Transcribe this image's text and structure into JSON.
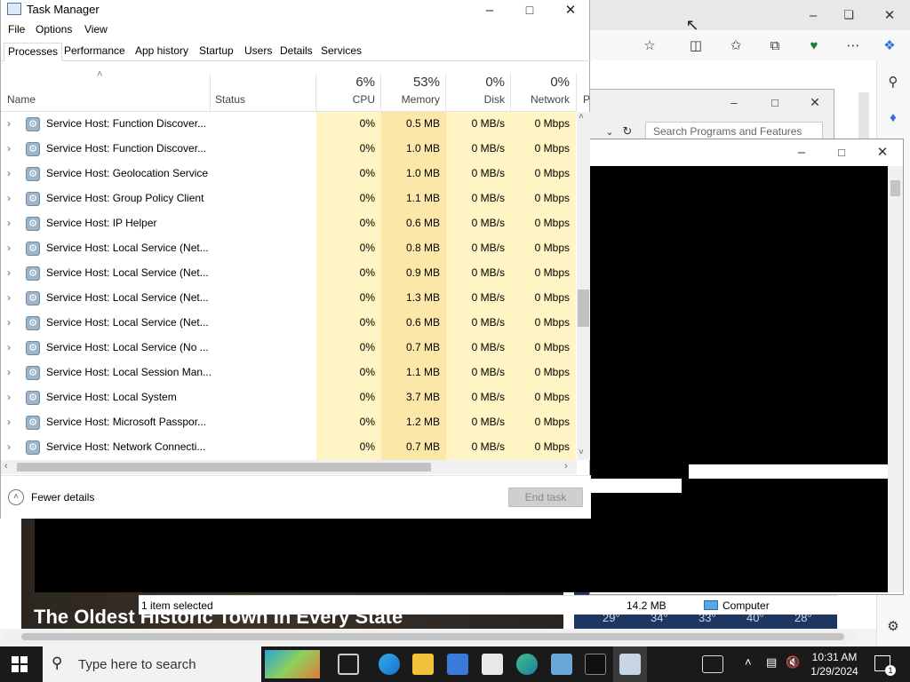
{
  "edge": {
    "search_programs_placeholder": "Search Programs and Features",
    "headline": "The Oldest Historic Town In Every State",
    "weather_temps": [
      "29°",
      "34°",
      "33°",
      "40°",
      "28°"
    ]
  },
  "console_status": {
    "selected": "1 item selected",
    "size": "14.2 MB",
    "location": "Computer"
  },
  "task_manager": {
    "title": "Task Manager",
    "menu": [
      "File",
      "Options",
      "View"
    ],
    "tabs": [
      "Processes",
      "Performance",
      "App history",
      "Startup",
      "Users",
      "Details",
      "Services"
    ],
    "active_tab": "Processes",
    "columns": {
      "name": "Name",
      "status": "Status",
      "cpu_pct": "6%",
      "cpu": "CPU",
      "mem_pct": "53%",
      "mem": "Memory",
      "disk_pct": "0%",
      "disk": "Disk",
      "net_pct": "0%",
      "net": "Network",
      "power": "P"
    },
    "rows": [
      {
        "name": "Service Host: Function Discover...",
        "cpu": "0%",
        "memory": "0.5 MB",
        "disk": "0 MB/s",
        "network": "0 Mbps"
      },
      {
        "name": "Service Host: Function Discover...",
        "cpu": "0%",
        "memory": "1.0 MB",
        "disk": "0 MB/s",
        "network": "0 Mbps"
      },
      {
        "name": "Service Host: Geolocation Service",
        "cpu": "0%",
        "memory": "1.0 MB",
        "disk": "0 MB/s",
        "network": "0 Mbps"
      },
      {
        "name": "Service Host: Group Policy Client",
        "cpu": "0%",
        "memory": "1.1 MB",
        "disk": "0 MB/s",
        "network": "0 Mbps"
      },
      {
        "name": "Service Host: IP Helper",
        "cpu": "0%",
        "memory": "0.6 MB",
        "disk": "0 MB/s",
        "network": "0 Mbps"
      },
      {
        "name": "Service Host: Local Service (Net...",
        "cpu": "0%",
        "memory": "0.8 MB",
        "disk": "0 MB/s",
        "network": "0 Mbps"
      },
      {
        "name": "Service Host: Local Service (Net...",
        "cpu": "0%",
        "memory": "0.9 MB",
        "disk": "0 MB/s",
        "network": "0 Mbps"
      },
      {
        "name": "Service Host: Local Service (Net...",
        "cpu": "0%",
        "memory": "1.3 MB",
        "disk": "0 MB/s",
        "network": "0 Mbps"
      },
      {
        "name": "Service Host: Local Service (Net...",
        "cpu": "0%",
        "memory": "0.6 MB",
        "disk": "0 MB/s",
        "network": "0 Mbps"
      },
      {
        "name": "Service Host: Local Service (No ...",
        "cpu": "0%",
        "memory": "0.7 MB",
        "disk": "0 MB/s",
        "network": "0 Mbps"
      },
      {
        "name": "Service Host: Local Session Man...",
        "cpu": "0%",
        "memory": "1.1 MB",
        "disk": "0 MB/s",
        "network": "0 Mbps"
      },
      {
        "name": "Service Host: Local System",
        "cpu": "0%",
        "memory": "3.7 MB",
        "disk": "0 MB/s",
        "network": "0 Mbps"
      },
      {
        "name": "Service Host: Microsoft Passpor...",
        "cpu": "0%",
        "memory": "1.2 MB",
        "disk": "0 MB/s",
        "network": "0 Mbps"
      },
      {
        "name": "Service Host: Network Connecti...",
        "cpu": "0%",
        "memory": "0.7 MB",
        "disk": "0 MB/s",
        "network": "0 Mbps"
      }
    ],
    "footer": {
      "fewer_details": "Fewer details",
      "end_task": "End task"
    }
  },
  "taskbar": {
    "search_placeholder": "Type here to search",
    "time": "10:31 AM",
    "date": "1/29/2024",
    "notification_count": "1"
  },
  "colors": {
    "cpu_col": "#fff4c4",
    "mem_col": "#fbe8a8",
    "taskbar": "#1a1a1a"
  }
}
